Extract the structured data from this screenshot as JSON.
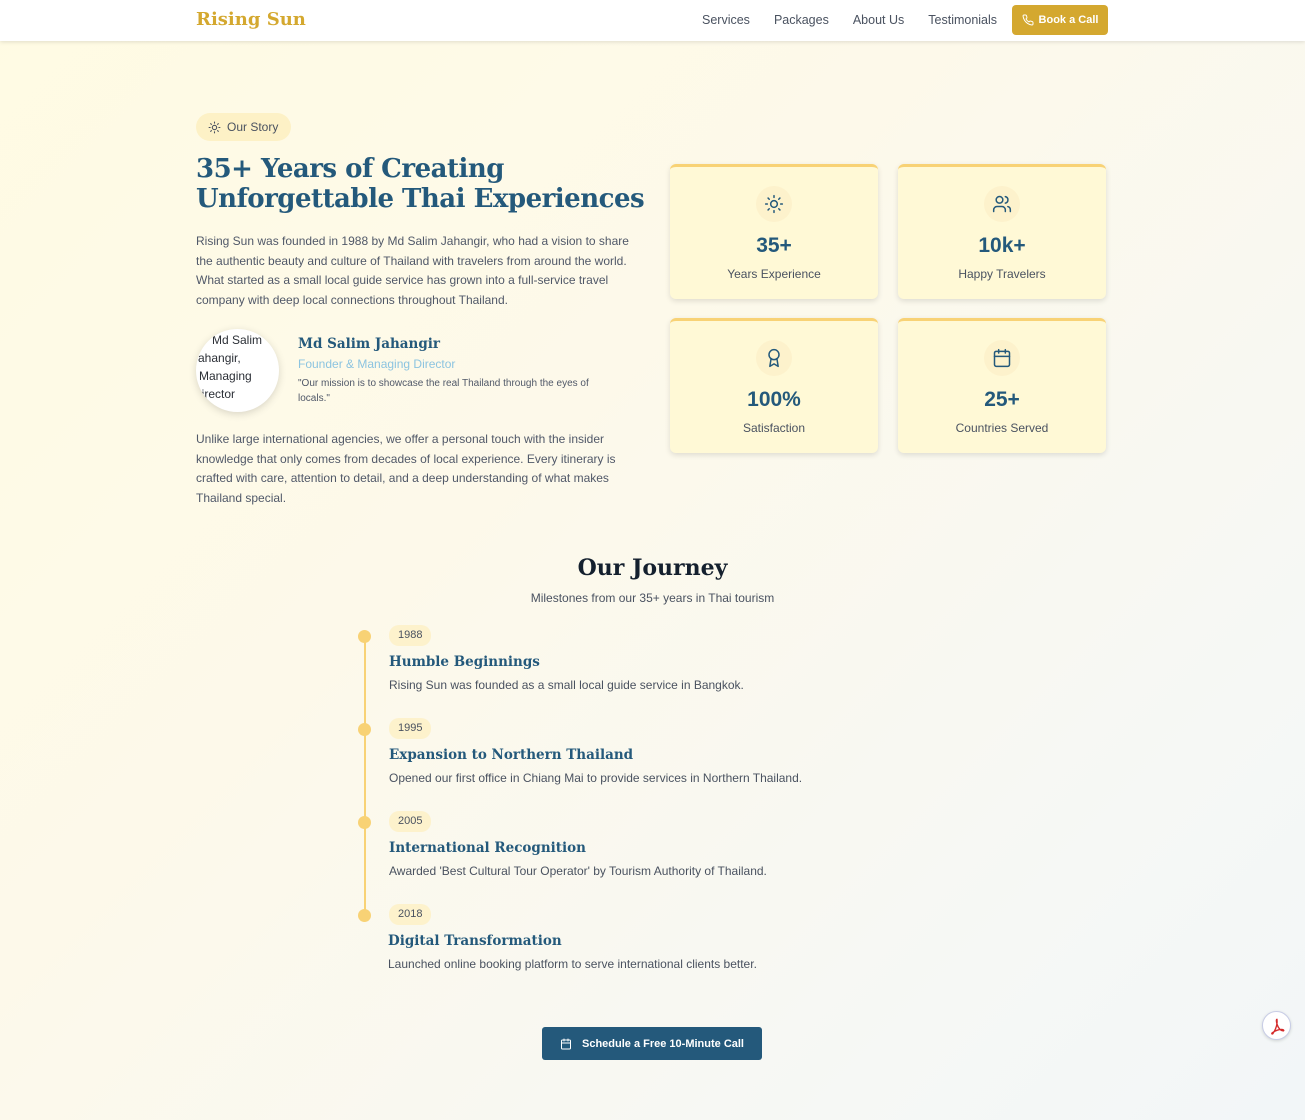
{
  "header": {
    "brand": "Rising Sun",
    "nav": [
      "Services",
      "Packages",
      "About Us",
      "Testimonials"
    ],
    "cta_label": "Book a Call",
    "cta_icon": "phone-icon"
  },
  "story": {
    "pill_label": "Our Story",
    "pill_icon": "sun-icon",
    "title": "35+ Years of Creating Unforgettable Thai Experiences",
    "paragraph1": "Rising Sun was founded in 1988 by Md Salim Jahangir, who had a vision to share the authentic beauty and culture of Thailand with travelers from around the world. What started as a small local guide service has grown into a full-service travel company with deep local connections throughout Thailand.",
    "avatar_alt_lines": [
      "Md Salim",
      "Jahangir,",
      "Managing",
      "Director"
    ],
    "founder_name": "Md Salim Jahangir",
    "founder_role": "Founder & Managing Director",
    "founder_quote": "\"Our mission is to showcase the real Thailand through the eyes of locals.\"",
    "paragraph2": "Unlike large international agencies, we offer a personal touch with the insider knowledge that only comes from decades of local experience. Every itinerary is crafted with care, attention to detail, and a deep understanding of what makes Thailand special."
  },
  "stats": [
    {
      "value": "35+",
      "label": "Years Experience",
      "icon": "sun-icon"
    },
    {
      "value": "10k+",
      "label": "Happy Travelers",
      "icon": "users-icon"
    },
    {
      "value": "100%",
      "label": "Satisfaction",
      "icon": "award-icon"
    },
    {
      "value": "25+",
      "label": "Countries Served",
      "icon": "calendar-icon"
    }
  ],
  "journey": {
    "title": "Our Journey",
    "subtitle": "Milestones from our 35+ years in Thai tourism",
    "milestones": [
      {
        "year": "1988",
        "title": "Humble Beginnings",
        "description": "Rising Sun was founded as a small local guide service in Bangkok."
      },
      {
        "year": "1995",
        "title": "Expansion to Northern Thailand",
        "description": "Opened our first office in Chiang Mai to provide services in Northern Thailand."
      },
      {
        "year": "2005",
        "title": "International Recognition",
        "description": "Awarded 'Best Cultural Tour Operator' by Tourism Authority of Thailand."
      },
      {
        "year": "2018",
        "title": "Digital Transformation",
        "description": "Launched online booking platform to serve international clients better."
      }
    ],
    "cta_label": "Schedule a Free 10-Minute Call",
    "cta_icon": "calendar-icon"
  },
  "floating": {
    "icon": "pdf-icon"
  },
  "colors": {
    "gold": "#d4a82f",
    "navy": "#24597b",
    "accent_yellow": "#f8d275",
    "card_bg": "#fff9d6"
  }
}
